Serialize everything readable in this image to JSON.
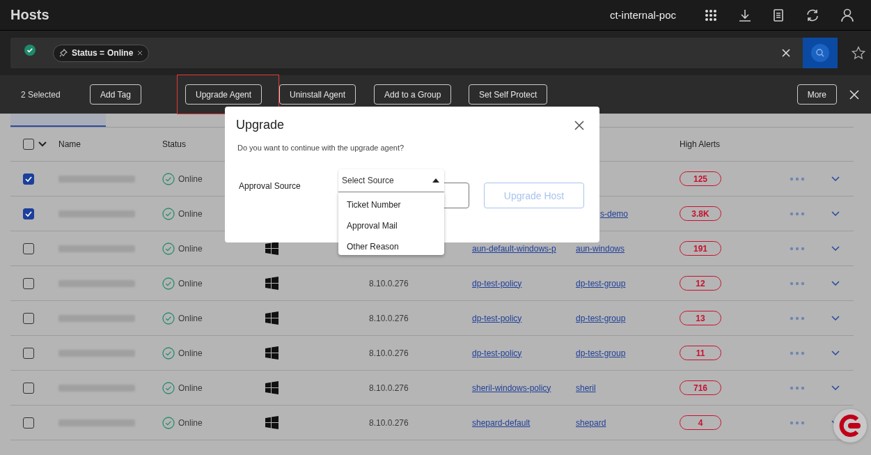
{
  "header": {
    "title": "Hosts",
    "account": "ct-internal-poc"
  },
  "filter_bar": {
    "chips": [
      {
        "field": "Status =",
        "value": "Online"
      }
    ]
  },
  "action_bar": {
    "selected_count": "2 Selected",
    "buttons": [
      {
        "label": "Add Tag",
        "highlighted": false
      },
      {
        "label": "Upgrade Agent",
        "highlighted": true
      },
      {
        "label": "Uninstall Agent",
        "highlighted": false
      },
      {
        "label": "Add to a Group",
        "highlighted": false
      },
      {
        "label": "Set Self Protect",
        "highlighted": false
      }
    ],
    "more": "More"
  },
  "tabs": [
    {
      "selected": true
    }
  ],
  "table": {
    "all_checked": false,
    "columns": [
      {
        "label": "Name"
      },
      {
        "label": "Status"
      },
      {
        "label": "High Alerts"
      }
    ],
    "rows": [
      {
        "checked": true,
        "name": {
          "kind": "blurred"
        },
        "status": "Online",
        "alerts": "125"
      },
      {
        "checked": true,
        "name": {
          "kind": "blurred"
        },
        "status": "Online",
        "group": "s-demo",
        "group_cut": true,
        "alerts": "3.8K"
      },
      {
        "checked": false,
        "name": {
          "kind": "blurred"
        },
        "status": "Online",
        "os_icon": true,
        "policy": "aun-default-windows-p",
        "group": "aun-windows",
        "alerts": "191"
      },
      {
        "checked": false,
        "name": {
          "kind": "blurred"
        },
        "status": "Online",
        "os_icon": true,
        "version": "8.10.0.276",
        "policy": "dp-test-policy",
        "group": "dp-test-group",
        "alerts": "12"
      },
      {
        "checked": false,
        "name": {
          "kind": "blurred"
        },
        "status": "Online",
        "os_icon": true,
        "version": "8.10.0.276",
        "policy": "dp-test-policy",
        "group": "dp-test-group",
        "alerts": "13"
      },
      {
        "checked": false,
        "name": {
          "kind": "blurred"
        },
        "status": "Online",
        "os_icon": true,
        "version": "8.10.0.276",
        "policy": "dp-test-policy",
        "group": "dp-test-group",
        "alerts": "11"
      },
      {
        "checked": false,
        "name": {
          "kind": "blurred"
        },
        "status": "Online",
        "os_icon": true,
        "version": "8.10.0.276",
        "policy": "sheril-windows-policy",
        "group": "sheril",
        "alerts": "716"
      },
      {
        "checked": false,
        "name": {
          "kind": "blurred"
        },
        "status": "Online",
        "os_icon": true,
        "version": "8.10.0.276",
        "policy": "shepard-default",
        "group": "shepard",
        "alerts": "4"
      }
    ]
  },
  "modal": {
    "title": "Upgrade",
    "message": "Do you want to continue with the upgrade agent?",
    "field_label": "Approval Source",
    "select": {
      "placeholder": "Select Source",
      "expanded": true,
      "options": [
        "Ticket Number",
        "Approval Mail",
        "Other Reason"
      ]
    },
    "buttons": [
      {
        "kind": "secondary"
      },
      {
        "kind": "primary",
        "label": "Upgrade Host",
        "disabled": true
      }
    ]
  }
}
